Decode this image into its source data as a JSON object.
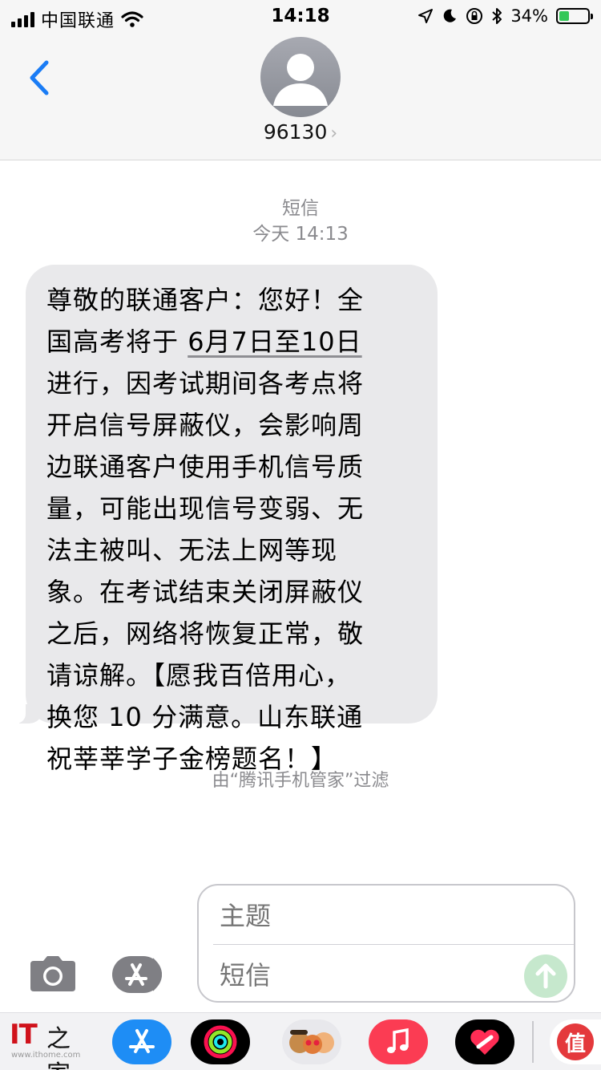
{
  "status_bar": {
    "carrier": "中国联通",
    "time": "14:18",
    "battery_percent": "34%",
    "battery_level": 0.34,
    "icons": [
      "signal-icon",
      "wifi-icon",
      "location-icon",
      "moon-icon",
      "rotation-lock-icon",
      "bluetooth-icon",
      "battery-charging-icon"
    ]
  },
  "header": {
    "contact": "96130",
    "contact_chevron": "›"
  },
  "conversation": {
    "message_type": "短信",
    "timestamp": "今天 14:13",
    "message_lines": [
      "尊敬的联通客户：您好！全",
      "国高考将于",
      "6月7日至10日",
      "进行，因考试期间各考点将",
      "开启信号屏蔽仪，会影响周",
      "边联通客户使用手机信号质",
      "量，可能出现信号变弱、无",
      "法主被叫、无法上网等现",
      "象。在考试结束关闭屏蔽仪",
      "之后，网络将恢复正常，敬",
      "请谅解。【愿我百倍用心，",
      "换您 10 分满意。山东联通",
      "祝莘莘学子金榜题名！】"
    ],
    "filter_note": "由“腾讯手机管家”过滤"
  },
  "composer": {
    "subject_placeholder": "主题",
    "body_placeholder": "短信"
  },
  "app_drawer": {
    "apps": [
      "photos-app-icon",
      "app-store-icon",
      "activity-icon",
      "memoji-icon",
      "music-icon",
      "digital-touch-icon",
      "smzdm-icon"
    ],
    "smzdm_label": "值"
  },
  "watermark": {
    "it": "IT",
    "home": "之家",
    "url": "www.ithome.com"
  },
  "colors": {
    "accent": "#1a7cf5",
    "bubble": "#e9e9eb",
    "send_disabled": "#c6e8cd",
    "battery_fill": "#34c759"
  }
}
